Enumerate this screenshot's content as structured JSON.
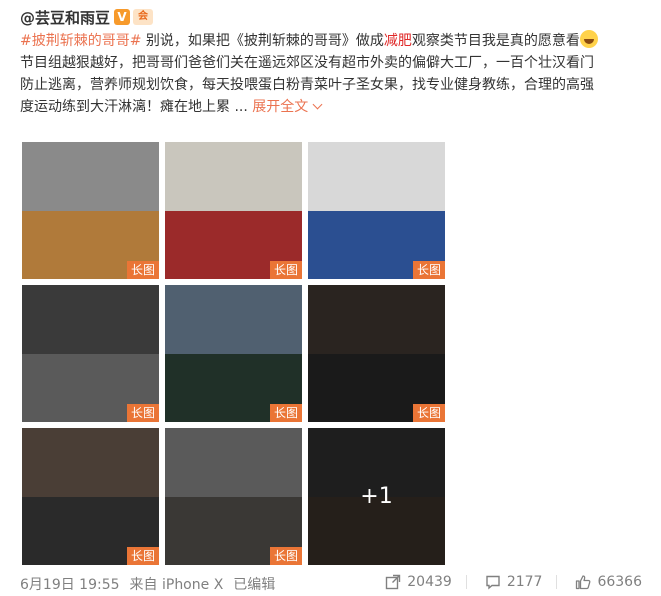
{
  "post": {
    "author": "@芸豆和雨豆",
    "verified_badge": "V",
    "member_badge": "会",
    "text": {
      "hashtag": "#披荆斩棘的哥哥#",
      "line1_a": " 别说，如果把《披荆斩棘的哥哥》做成",
      "line1_hl": "减肥",
      "line1_b": "观察类节目我是真的愿意看",
      "line2": "节目组越狠越好，把哥哥们爸爸们关在遥远郊区没有超市外卖的偏僻大工厂，一百个壮汉看门",
      "line3": "防止逃离，营养师规划饮食，每天投喂蛋白粉青菜叶子圣女果，找专业健身教练，合理的高强",
      "line4": "度运动练到大汗淋漓！瘫在地上累 ...",
      "expand": "展开全文"
    },
    "images": [
      {
        "label": "长图",
        "top": "#8a8a8a",
        "bottom": "#b07a3a"
      },
      {
        "label": "长图",
        "top": "#c9c6bd",
        "bottom": "#9b2a2a"
      },
      {
        "label": "长图",
        "top": "#d8d8d8",
        "bottom": "#2b4f91"
      },
      {
        "label": "长图",
        "top": "#3a3a3a",
        "bottom": "#5a5a5a"
      },
      {
        "label": "长图",
        "top": "#506070",
        "bottom": "#203028"
      },
      {
        "label": "长图",
        "top": "#2a2420",
        "bottom": "#1a1a1a"
      },
      {
        "label": "长图",
        "top": "#4a3e36",
        "bottom": "#2a2a2a"
      },
      {
        "label": "长图",
        "top": "#5a5a5a",
        "bottom": "#3a3835"
      },
      {
        "label": "+1",
        "top": "#2e2e2e",
        "bottom": "#3a3028"
      }
    ],
    "footer": {
      "date": "6月19日 19:55",
      "source": "来自 iPhone X",
      "edited": "已编辑",
      "reposts": "20439",
      "comments": "2177",
      "likes": "66366"
    }
  }
}
